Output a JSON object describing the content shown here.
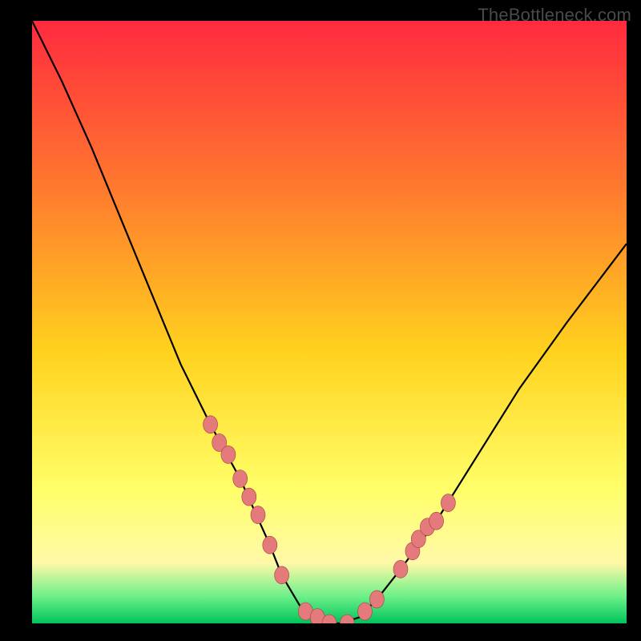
{
  "watermark": "TheBottleneck.com",
  "colors": {
    "frame_bg": "#000000",
    "gradient_top": "#ff2a3f",
    "gradient_mid_upper": "#ff7a2e",
    "gradient_mid": "#ffd21e",
    "gradient_mid_lower": "#ffff6a",
    "gradient_lower": "#fff8a8",
    "gradient_green_band": "#6df089",
    "gradient_green_bottom": "#00c45b",
    "curve_stroke": "#000000",
    "marker_fill": "#e47a7b",
    "marker_stroke": "#a03f3f"
  },
  "chart_data": {
    "type": "line",
    "title": "",
    "xlabel": "",
    "ylabel": "",
    "xlim": [
      0,
      100
    ],
    "ylim": [
      0,
      100
    ],
    "grid": false,
    "series": [
      {
        "name": "bottleneck-curve",
        "x": [
          0,
          5,
          10,
          15,
          20,
          25,
          30,
          35,
          40,
          42,
          45,
          48,
          50,
          52,
          55,
          58,
          62,
          68,
          75,
          82,
          90,
          100
        ],
        "y": [
          100,
          90,
          79,
          67,
          55,
          43,
          33,
          24,
          13,
          8,
          3,
          1,
          0,
          0,
          1,
          4,
          9,
          17,
          28,
          39,
          50,
          63
        ]
      }
    ],
    "markers": {
      "name": "highlighted-points",
      "x": [
        30,
        31.5,
        33,
        35,
        36.5,
        38,
        40,
        42,
        46,
        48,
        50,
        53,
        56,
        58,
        62,
        64,
        65,
        66.5,
        68,
        70
      ],
      "y": [
        33,
        30,
        28,
        24,
        21,
        18,
        13,
        8,
        2,
        1,
        0,
        0,
        2,
        4,
        9,
        12,
        14,
        16,
        17,
        20
      ]
    }
  }
}
